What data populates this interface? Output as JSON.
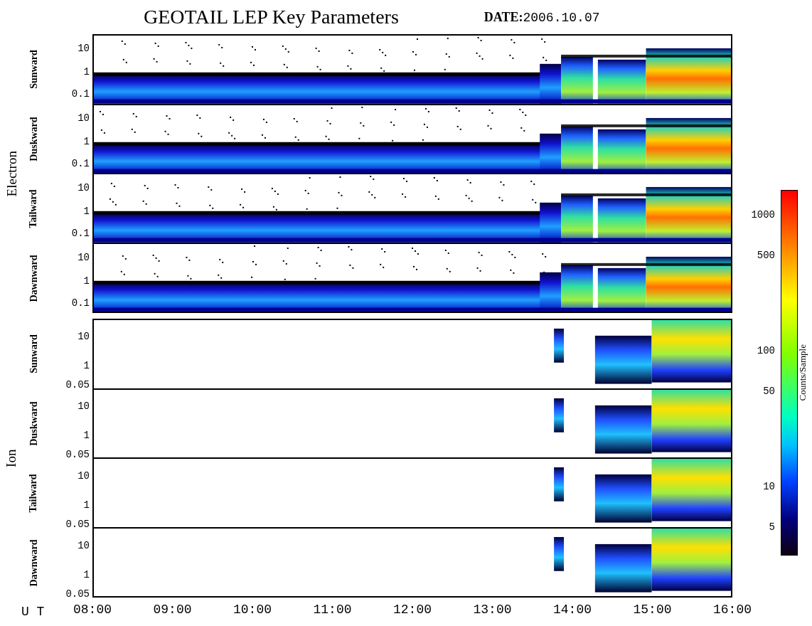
{
  "title": "GEOTAIL LEP Key Parameters",
  "date": {
    "label": "DATE:",
    "value": "2006.10.07"
  },
  "groups": [
    {
      "species": "Electron",
      "kind": "electron",
      "panels": [
        {
          "direction": "Sunward",
          "yticks": [
            "10",
            "1",
            "0.1"
          ]
        },
        {
          "direction": "Duskward",
          "yticks": [
            "10",
            "1",
            "0.1"
          ]
        },
        {
          "direction": "Tailward",
          "yticks": [
            "10",
            "1",
            "0.1"
          ]
        },
        {
          "direction": "Dawnward",
          "yticks": [
            "10",
            "1",
            "0.1"
          ]
        }
      ]
    },
    {
      "species": "Ion",
      "kind": "ion",
      "panels": [
        {
          "direction": "Sunward",
          "yticks": [
            "10",
            "1",
            "0.05"
          ]
        },
        {
          "direction": "Duskward",
          "yticks": [
            "10",
            "1",
            "0.05"
          ]
        },
        {
          "direction": "Tailward",
          "yticks": [
            "10",
            "1",
            "0.05"
          ]
        },
        {
          "direction": "Dawnward",
          "yticks": [
            "10",
            "1",
            "0.05"
          ]
        }
      ]
    }
  ],
  "time_axis": {
    "label": "U T",
    "ticks": [
      "08:00",
      "09:00",
      "10:00",
      "11:00",
      "12:00",
      "13:00",
      "14:00",
      "15:00",
      "16:00"
    ]
  },
  "colorbar": {
    "label": "Counts/Sample",
    "ticks": [
      "1000",
      "500",
      "100",
      "50",
      "10",
      "5"
    ]
  }
}
